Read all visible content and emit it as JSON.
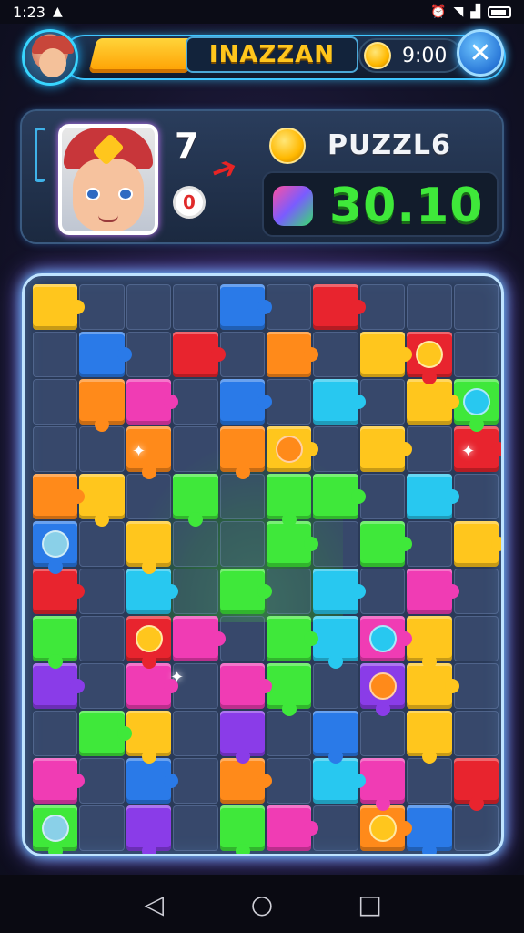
{
  "status_bar": {
    "time": "1:23",
    "left_icon": "notification-icon",
    "right_icons": [
      "alarm-icon",
      "wifi-icon",
      "signal-icon",
      "battery-icon"
    ]
  },
  "top_bar": {
    "player_name": "INAZZAN",
    "timer": "9:00",
    "close_symbol": "✕",
    "coin_symbol": "◉"
  },
  "info_panel": {
    "level": "7",
    "badge": "0",
    "game_title": "PUZZL6",
    "score": "30.10"
  },
  "board": {
    "accent_colors": {
      "yellow": "#ffc61d",
      "red": "#e8242e",
      "orange": "#ff8a1a",
      "green": "#3fe83a",
      "cyan": "#28c8f0",
      "blue": "#2a7ae8",
      "magenta": "#f03cb4",
      "purple": "#8a3ce8"
    }
  },
  "nav_bar": {
    "back": "◁",
    "home": "○",
    "recents": "□"
  }
}
